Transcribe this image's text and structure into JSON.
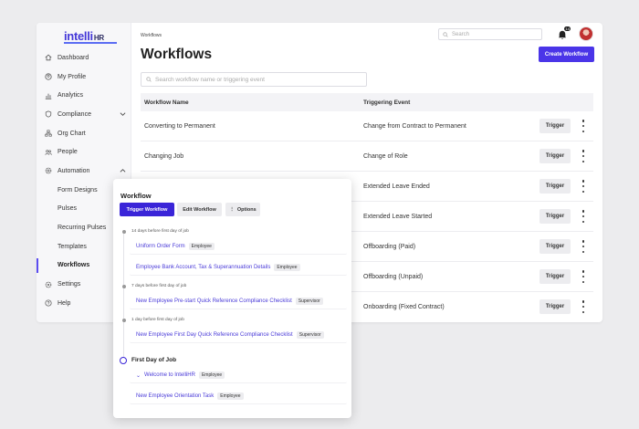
{
  "sidebar": {
    "logo": "intelli",
    "logo_suffix": "HR",
    "items": [
      {
        "label": "Dashboard",
        "icon": "home-icon"
      },
      {
        "label": "My Profile",
        "icon": "user-icon"
      },
      {
        "label": "Analytics",
        "icon": "bar-chart-icon"
      },
      {
        "label": "Compliance",
        "icon": "shield-icon"
      },
      {
        "label": "Org Chart",
        "icon": "org-chart-icon"
      },
      {
        "label": "People",
        "icon": "people-icon"
      },
      {
        "label": "Automation",
        "icon": "gear-icon"
      },
      {
        "label": "Form Designs"
      },
      {
        "label": "Pulses"
      },
      {
        "label": "Recurring Pulses"
      },
      {
        "label": "Templates"
      },
      {
        "label": "Workflows"
      },
      {
        "label": "Settings",
        "icon": "settings-icon"
      },
      {
        "label": "Help",
        "icon": "help-icon"
      }
    ]
  },
  "header": {
    "breadcrumb": "Workflows",
    "title": "Workflows",
    "search_placeholder": "Search",
    "notification_count": "14",
    "create_label": "Create Workflow"
  },
  "main": {
    "search_placeholder": "Search workflow name or triggering event",
    "columns": [
      "Workflow Name",
      "Triggering Event"
    ],
    "trigger_label": "Trigger",
    "rows": [
      {
        "name": "Converting to Permanent",
        "event": "Change from Contract to Permanent"
      },
      {
        "name": "Changing Job",
        "event": "Change of Role"
      },
      {
        "name": "",
        "event": "Extended Leave Ended"
      },
      {
        "name": "",
        "event": "Extended Leave Started"
      },
      {
        "name": "",
        "event": "Offboarding (Paid)"
      },
      {
        "name": "",
        "event": "Offboarding (Unpaid)"
      },
      {
        "name": "",
        "event": "Onboarding (Fixed Contract)"
      }
    ]
  },
  "popup": {
    "title": "Workflow",
    "trigger_workflow_label": "Trigger Workflow",
    "edit_workflow_label": "Edit Workflow",
    "options_label": "Options",
    "groups": [
      {
        "label": "14 days before first day of job",
        "items": [
          {
            "title": "Uniform Order Form",
            "tag": "Employee"
          },
          {
            "title": "Employee Bank Account, Tax & Superannuation Details",
            "tag": "Employee"
          }
        ]
      },
      {
        "label": "7 days before first day of job",
        "items": [
          {
            "title": "New Employee Pre-start Quick Reference Compliance Checklist",
            "tag": "Supervisor"
          }
        ]
      },
      {
        "label": "1 day before first day of job",
        "items": [
          {
            "title": "New Employee First Day Quick Reference Compliance Checklist",
            "tag": "Supervisor"
          }
        ]
      }
    ],
    "first_day": {
      "label": "First Day of Job",
      "items": [
        {
          "title": "Welcome to IntelliHR",
          "tag": "Employee"
        },
        {
          "title": "New Employee Orientation Task",
          "tag": "Employee"
        }
      ]
    }
  },
  "colors": {
    "accent": "#4a35e8",
    "link": "#4a3bd8"
  }
}
